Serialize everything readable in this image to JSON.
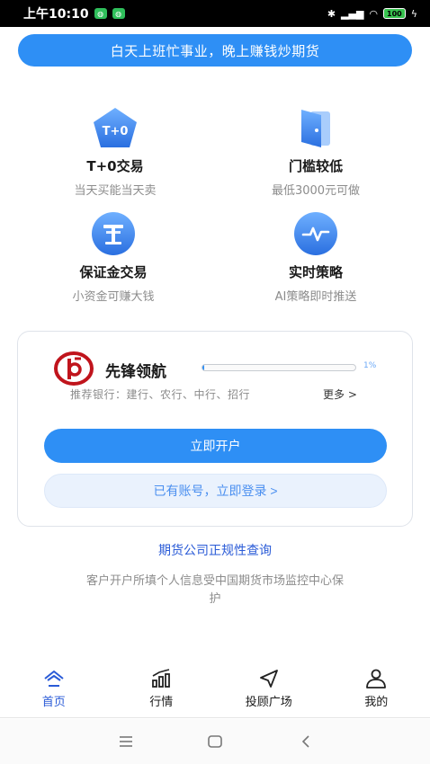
{
  "status_bar": {
    "time": "上午10:10",
    "battery": "100"
  },
  "banner": {
    "text": "白天上班忙事业，晚上赚钱炒期货"
  },
  "features": [
    {
      "icon": "pentagon-tplus0-icon",
      "icon_text": "T+0",
      "title": "T+0交易",
      "desc": "当天买能当天卖"
    },
    {
      "icon": "door-icon",
      "title": "门槛较低",
      "desc": "最低3000元可做"
    },
    {
      "icon": "margin-t-icon",
      "title": "保证金交易",
      "desc": "小资金可赚大钱"
    },
    {
      "icon": "pulse-icon",
      "title": "实时策略",
      "desc": "AI策略即时推送"
    }
  ],
  "card": {
    "brand_name": "先锋领航",
    "progress_percent": 1,
    "progress_label": "1%",
    "banks": "推荐银行：建行、农行、中行、招行",
    "more": "更多 >",
    "open_button": "立即开户",
    "login_button": "已有账号，立即登录 >"
  },
  "query_link": "期货公司正规性查询",
  "notice": "客户开户所填个人信息受中国期货市场监控中心保护",
  "tabbar": [
    {
      "icon": "home-icon",
      "label": "首页",
      "active": true
    },
    {
      "icon": "market-chart-icon",
      "label": "行情",
      "active": false
    },
    {
      "icon": "navigation-arrow-icon",
      "label": "投顾广场",
      "active": false
    },
    {
      "icon": "user-icon",
      "label": "我的",
      "active": false
    }
  ],
  "colors": {
    "accent": "#2e8ff5",
    "link": "#2a5bd7",
    "brand_red": "#c0141c"
  }
}
